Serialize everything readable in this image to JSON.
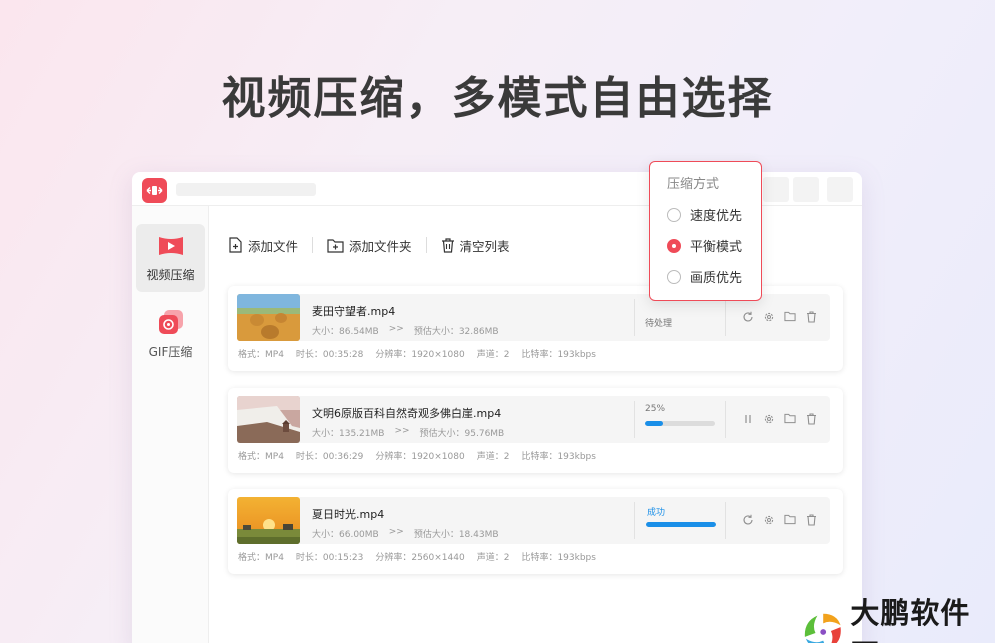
{
  "headline": "视频压缩，多模式自由选择",
  "sidebar": {
    "items": [
      {
        "label": "视频压缩",
        "icon": "video-play-icon",
        "active": true
      },
      {
        "label": "GIF压缩",
        "icon": "gif-icon",
        "active": false
      }
    ]
  },
  "toolbar": {
    "add_file": "添加文件",
    "add_folder": "添加文件夹",
    "clear_list": "清空列表"
  },
  "files": [
    {
      "name": "麦田守望者.mp4",
      "size": "大小：86.54MB",
      "arrow": ">>",
      "estimated": "预估大小：32.86MB",
      "status": "待处理",
      "meta": [
        "格式：MP4",
        "时长：00:35:28",
        "分辨率：1920×1080",
        "声道：2",
        "比特率：193kbps"
      ]
    },
    {
      "name": "文明6原版百科自然奇观多佛白崖.mp4",
      "size": "大小：135.21MB",
      "arrow": ">>",
      "estimated": "预估大小：95.76MB",
      "status": "25%",
      "progress": 0.25,
      "meta": [
        "格式：MP4",
        "时长：00:36:29",
        "分辨率：1920×1080",
        "声道：2",
        "比特率：193kbps"
      ]
    },
    {
      "name": "夏日时光.mp4",
      "size": "大小：66.00MB",
      "arrow": ">>",
      "estimated": "预估大小：18.43MB",
      "status": "成功",
      "progress": 1.0,
      "meta": [
        "格式：MP4",
        "时长：00:15:23",
        "分辨率：2560×1440",
        "声道：2",
        "比特率：193kbps"
      ]
    }
  ],
  "popup": {
    "title": "压缩方式",
    "options": [
      {
        "label": "速度优先",
        "selected": false
      },
      {
        "label": "平衡模式",
        "selected": true
      },
      {
        "label": "画质优先",
        "selected": false
      }
    ]
  },
  "brand": {
    "name": "大鹏软件园"
  },
  "colors": {
    "accent": "#ef4b58",
    "progress": "#1a8fe8"
  }
}
